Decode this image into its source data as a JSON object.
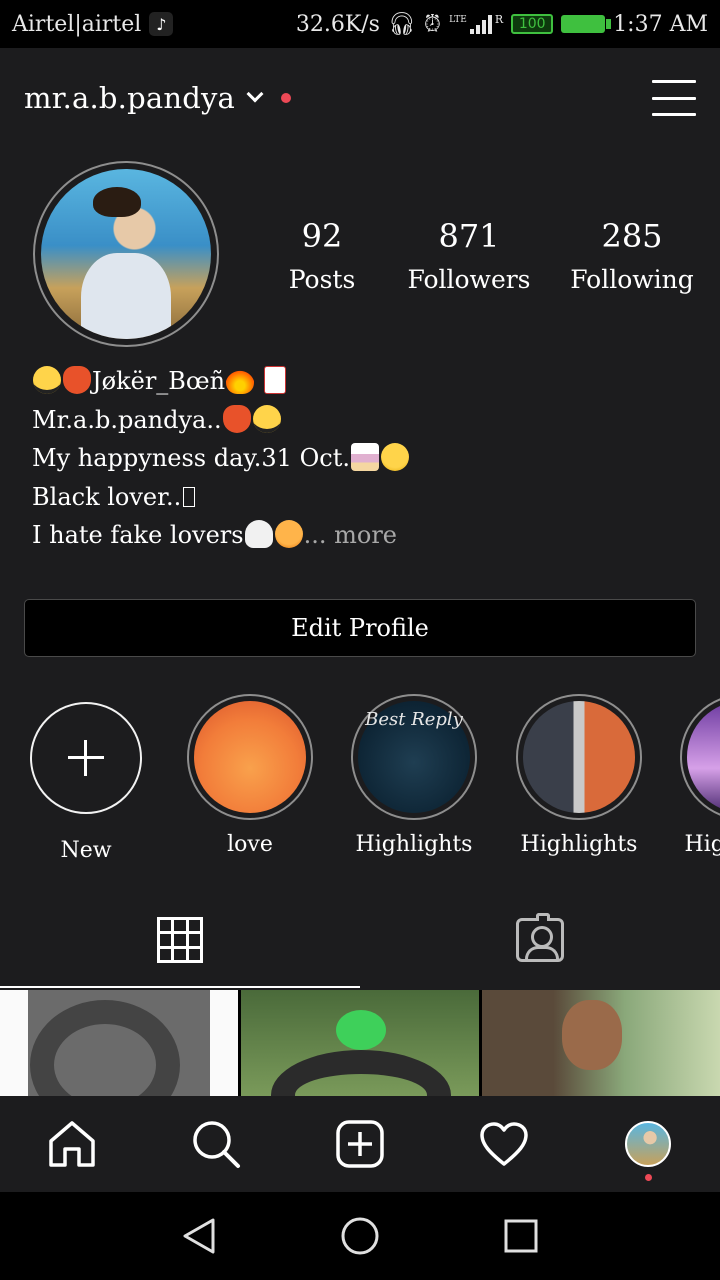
{
  "status_bar": {
    "carrier": "Airtel|airtel",
    "speed": "32.6K/s",
    "lte": "LTE",
    "roaming": "R",
    "battery": "100",
    "time": "1:37 AM"
  },
  "header": {
    "username": "mr.a.b.pandya"
  },
  "stats": {
    "posts": {
      "count": "92",
      "label": "Posts"
    },
    "followers": {
      "count": "871",
      "label": "Followers"
    },
    "following": {
      "count": "285",
      "label": "Following"
    }
  },
  "bio": {
    "line1": "Jøkër_Bœñ",
    "line2": "Mr.a.b.pandya..",
    "line3": "My happyness day.31 Oct.",
    "line4": "Black lover..",
    "line5": "I hate fake lovers",
    "more": "... more"
  },
  "edit_profile_label": "Edit Profile",
  "highlights": [
    {
      "label": "New"
    },
    {
      "label": "love"
    },
    {
      "label": "Highlights",
      "cover_text": "Best Reply"
    },
    {
      "label": "Highlights"
    },
    {
      "label": "Highlights"
    }
  ],
  "icons": {
    "nav": [
      "home-icon",
      "search-icon",
      "add-post-icon",
      "heart-icon",
      "profile-avatar"
    ],
    "tabs": [
      "grid-icon",
      "tagged-icon"
    ]
  },
  "colors": {
    "background": "#1c1c1e",
    "notification_red": "#ed4956",
    "battery_green": "#3fc03f"
  }
}
